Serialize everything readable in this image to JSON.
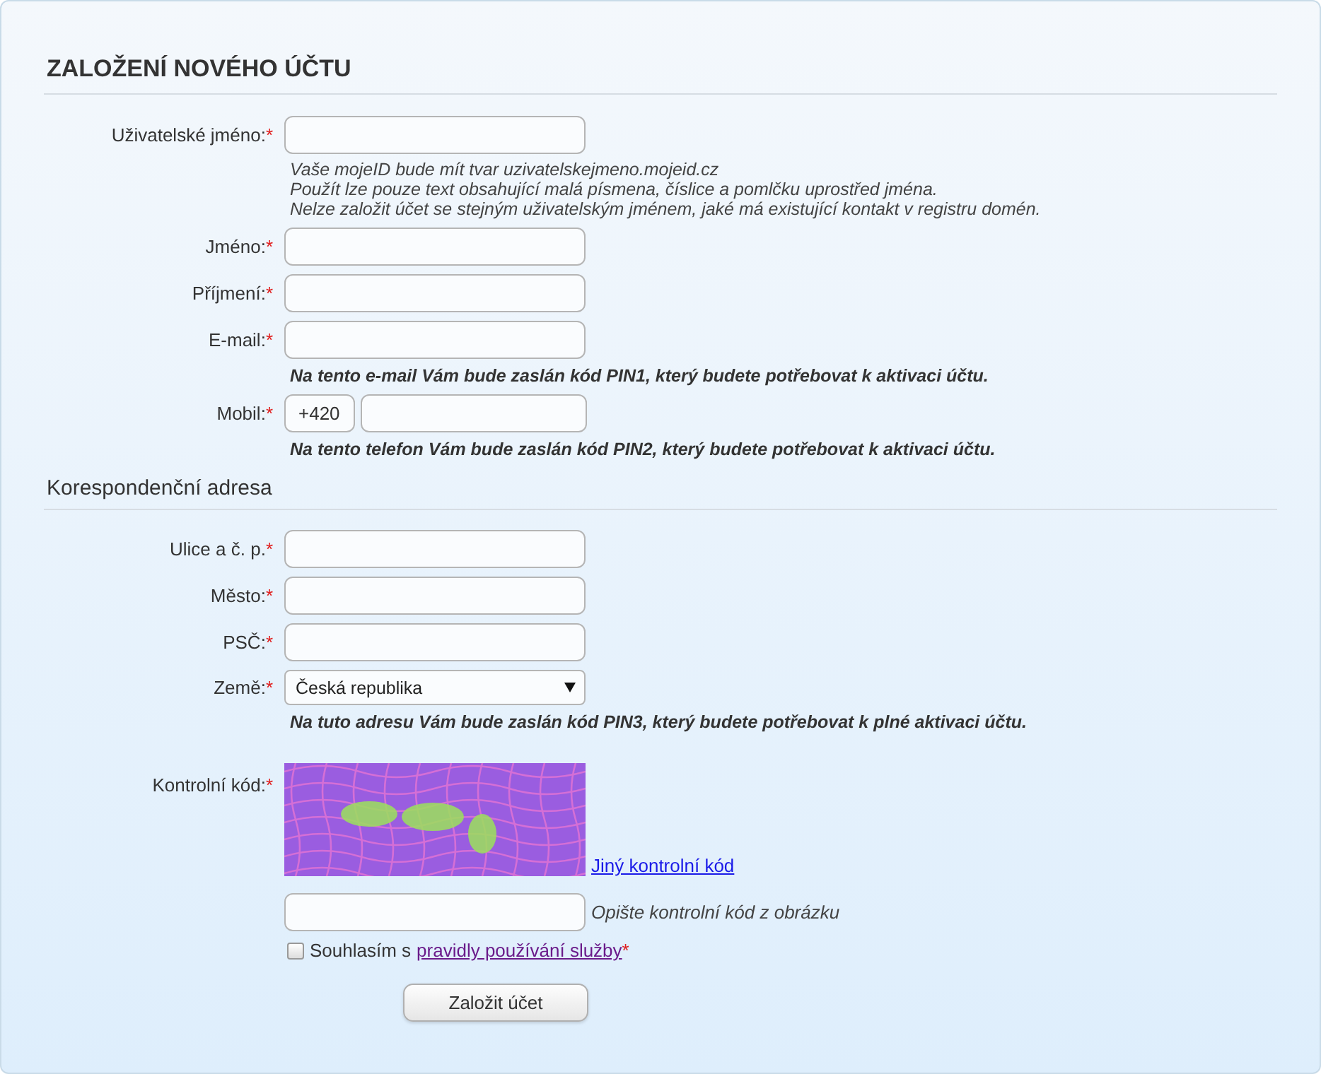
{
  "title": "ZALOŽENÍ NOVÉHO ÚČTU",
  "required_mark": "*",
  "sections": [
    {
      "fields": [
        {
          "kind": "text",
          "label": "Uživatelské jméno:",
          "required": true,
          "notes": [
            {
              "kind": "hint",
              "text": "Vaše mojeID bude mít tvar uzivatelskejmeno.mojeid.cz"
            },
            {
              "kind": "hint",
              "text": "Použít lze pouze text obsahující malá písmena, číslice a pomlčku uprostřed jména."
            },
            {
              "kind": "hint",
              "text": "Nelze založit účet se stejným uživatelským jménem, jaké má existující kontakt v registru domén."
            }
          ]
        },
        {
          "kind": "text",
          "label": "Jméno:",
          "required": true
        },
        {
          "kind": "text",
          "label": "Příjmení:",
          "required": true
        },
        {
          "kind": "text",
          "label": "E-mail:",
          "required": true,
          "notes": [
            {
              "kind": "notice",
              "text": "Na tento e-mail Vám bude zaslán kód PIN1, který budete potřebovat k aktivaci účtu."
            }
          ]
        },
        {
          "kind": "phone",
          "label": "Mobil:",
          "required": true,
          "prefix": "+420",
          "notes": [
            {
              "kind": "notice",
              "text": "Na tento telefon Vám bude zaslán kód PIN2, který budete potřebovat k aktivaci účtu."
            }
          ]
        }
      ]
    },
    {
      "heading": "Korespondenční adresa",
      "fields": [
        {
          "kind": "text",
          "label": "Ulice a č. p.",
          "required": true
        },
        {
          "kind": "text",
          "label": "Město:",
          "required": true
        },
        {
          "kind": "text",
          "label": "PSČ:",
          "required": true
        },
        {
          "kind": "select",
          "label": "Země:",
          "required": true,
          "value": "Česká republika",
          "notes": [
            {
              "kind": "notice",
              "text": "Na tuto adresu Vám bude zaslán kód PIN3, který budete potřebovat k plné aktivaci účtu."
            }
          ]
        },
        {
          "kind": "captcha",
          "label": "Kontrolní kód:",
          "required": true,
          "reload_link": "Jiný kontrolní kód",
          "input_hint": "Opište kontrolní kód z obrázku"
        }
      ]
    }
  ],
  "agree": {
    "checked": false,
    "text": "Souhlasím s",
    "link": "pravidly používání služby",
    "required": true
  },
  "submit": "Založit účet"
}
